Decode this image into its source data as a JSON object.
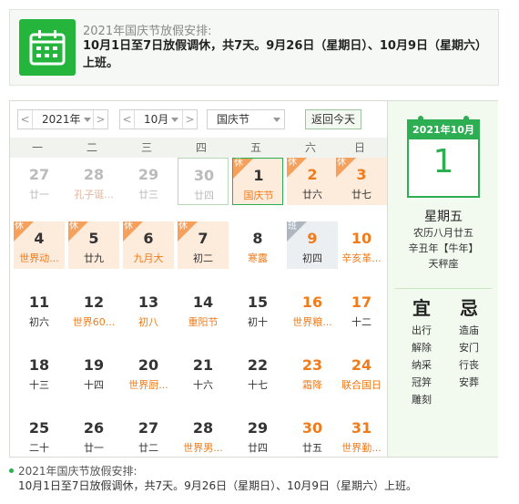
{
  "notice": {
    "title": "2021年国庆节放假安排:",
    "body": "10月1日至7日放假调休，共7天。9月26日（星期日）、10月9日（星期六）上班。"
  },
  "toolbar": {
    "year": "2021年",
    "month": "10月",
    "holiday": "国庆节",
    "today_label": "返回今天",
    "prev": "<",
    "next": ">"
  },
  "weekdays": [
    "一",
    "二",
    "三",
    "四",
    "五",
    "六",
    "日"
  ],
  "tags": {
    "rest": "休",
    "work": "班"
  },
  "days": [
    [
      {
        "d": "27",
        "l": "廿一",
        "other": true
      },
      {
        "d": "28",
        "l": "孔子诞...",
        "other": true,
        "fest": true
      },
      {
        "d": "29",
        "l": "廿三",
        "other": true
      },
      {
        "d": "30",
        "l": "廿四",
        "other": true,
        "outline": true
      },
      {
        "d": "1",
        "l": "国庆节",
        "holiday": true,
        "fest": true,
        "selected": true
      },
      {
        "d": "2",
        "l": "廿六",
        "holiday": true,
        "weekend": true
      },
      {
        "d": "3",
        "l": "廿七",
        "holiday": true,
        "weekend": true
      }
    ],
    [
      {
        "d": "4",
        "l": "世界动...",
        "holiday": true,
        "fest": true
      },
      {
        "d": "5",
        "l": "廿九",
        "holiday": true
      },
      {
        "d": "6",
        "l": "九月大",
        "holiday": true,
        "fest": true
      },
      {
        "d": "7",
        "l": "初二",
        "holiday": true
      },
      {
        "d": "8",
        "l": "寒露",
        "fest": true
      },
      {
        "d": "9",
        "l": "初四",
        "workday": true,
        "weekend": true
      },
      {
        "d": "10",
        "l": "辛亥革...",
        "weekend": true,
        "fest": true
      }
    ],
    [
      {
        "d": "11",
        "l": "初六"
      },
      {
        "d": "12",
        "l": "世界60...",
        "fest": true
      },
      {
        "d": "13",
        "l": "初八",
        "fest": true
      },
      {
        "d": "14",
        "l": "重阳节",
        "fest": true
      },
      {
        "d": "15",
        "l": "初十"
      },
      {
        "d": "16",
        "l": "世界粮...",
        "weekend": true,
        "fest": true
      },
      {
        "d": "17",
        "l": "十二",
        "weekend": true
      }
    ],
    [
      {
        "d": "18",
        "l": "十三"
      },
      {
        "d": "19",
        "l": "十四"
      },
      {
        "d": "20",
        "l": "世界厨...",
        "fest": true
      },
      {
        "d": "21",
        "l": "十六"
      },
      {
        "d": "22",
        "l": "十七"
      },
      {
        "d": "23",
        "l": "霜降",
        "weekend": true,
        "fest": true
      },
      {
        "d": "24",
        "l": "联合国日",
        "weekend": true,
        "fest": true
      }
    ],
    [
      {
        "d": "25",
        "l": "二十"
      },
      {
        "d": "26",
        "l": "廿一"
      },
      {
        "d": "27",
        "l": "廿二"
      },
      {
        "d": "28",
        "l": "世界男...",
        "fest": true
      },
      {
        "d": "29",
        "l": "廿四"
      },
      {
        "d": "30",
        "l": "廿五",
        "weekend": true
      },
      {
        "d": "31",
        "l": "世界勤...",
        "weekend": true,
        "fest": true
      }
    ]
  ],
  "side": {
    "header": "2021年10月",
    "day": "1",
    "weekday": "星期五",
    "lunar": "农历八月廿五",
    "ganzhi": "辛丑年【牛年】",
    "constellation": "天秤座",
    "yi_title": "宜",
    "ji_title": "忌",
    "yi": [
      "出行",
      "解除",
      "纳采",
      "冠笄",
      "雕刻"
    ],
    "ji": [
      "造庙",
      "安门",
      "行丧",
      "安葬"
    ]
  },
  "footer": {
    "title": "2021年国庆节放假安排:",
    "body": "10月1日至7日放假调休，共7天。9月26日（星期日）、10月9日（星期六）上班。"
  },
  "colors": {
    "accent": "#2eae52",
    "holiday_bg": "#fdebdc",
    "festival": "#f07b1b"
  }
}
